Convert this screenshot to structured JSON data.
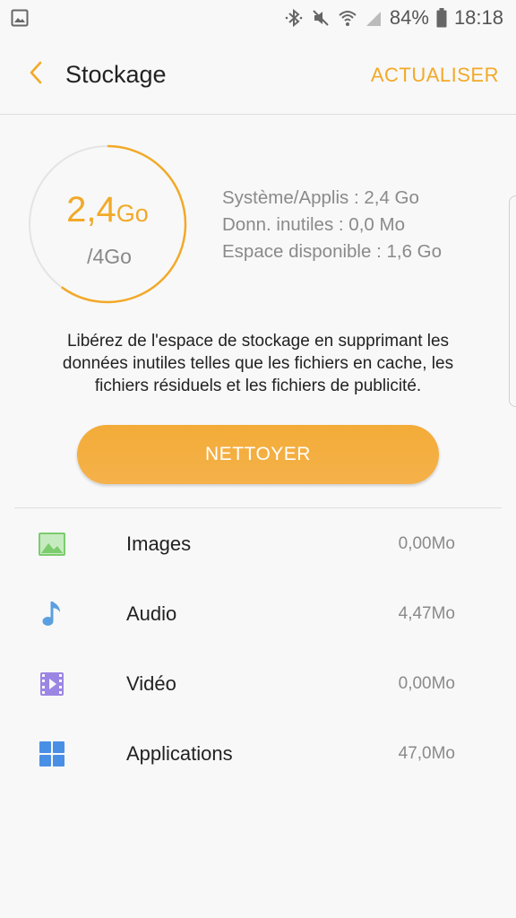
{
  "status_bar": {
    "battery": "84%",
    "time": "18:18",
    "icons": [
      "gallery-notification-icon",
      "bluetooth-icon",
      "mute-icon",
      "wifi-icon",
      "signal-icon",
      "battery-icon"
    ]
  },
  "header": {
    "title": "Stockage",
    "refresh_label": "ACTUALISER"
  },
  "storage": {
    "used_value": "2,4",
    "used_unit": "Go",
    "total": "/4Go",
    "used_fraction": 0.6,
    "system_apps": "Système/Applis : 2,4 Go",
    "junk_data": "Donn. inutiles : 0,0 Mo",
    "available": "Espace disponible : 1,6 Go"
  },
  "description": "Libérez de l'espace de stockage en supprimant les données inutiles telles que les fichiers en cache, les fichiers résiduels et les fichiers de publicité.",
  "clean_button_label": "NETTOYER",
  "categories": [
    {
      "label": "Images",
      "size": "0,00Mo",
      "icon": "image-icon",
      "color": "#7ccc6e"
    },
    {
      "label": "Audio",
      "size": "4,47Mo",
      "icon": "music-note-icon",
      "color": "#5aa0e0"
    },
    {
      "label": "Vidéo",
      "size": "0,00Mo",
      "icon": "video-icon",
      "color": "#9b86e4"
    },
    {
      "label": "Applications",
      "size": "47,0Mo",
      "icon": "apps-grid-icon",
      "color": "#4a8fe6"
    }
  ],
  "colors": {
    "accent": "#f2a928",
    "button": "#f5b043"
  }
}
